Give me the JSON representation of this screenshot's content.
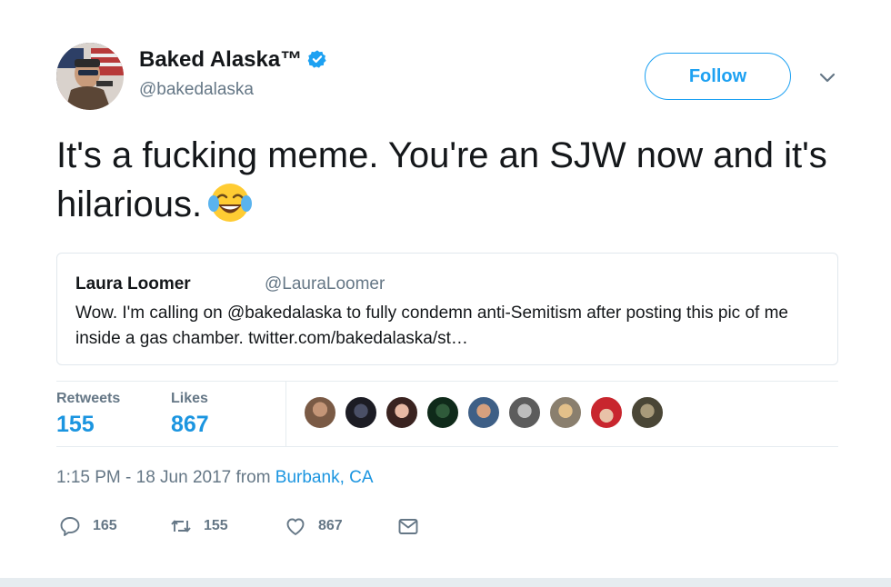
{
  "tweet": {
    "display_name": "Baked Alaska™",
    "handle": "@bakedalaska",
    "verified_icon": "verified-badge-icon",
    "follow_label": "Follow",
    "text": "It's a fucking meme. You're an SJW now and it's hilarious.",
    "emoji": "face-with-tears-of-joy-emoji",
    "accent_color": "#1da1f2"
  },
  "quote": {
    "name": "Laura Loomer",
    "handle": "@LauraLoomer",
    "text": "Wow. I'm calling on @bakedalaska to fully condemn anti-Semitism after posting this pic of me inside a gas chamber. twitter.com/bakedalaska/st…"
  },
  "stats": {
    "retweets_label": "Retweets",
    "retweets_value": "155",
    "likes_label": "Likes",
    "likes_value": "867",
    "liker_avatar_count": 9
  },
  "meta": {
    "time_date": "1:15 PM - 18 Jun 2017 from ",
    "location": "Burbank, CA"
  },
  "actions": {
    "replies": "165",
    "retweets": "155",
    "likes": "867"
  }
}
